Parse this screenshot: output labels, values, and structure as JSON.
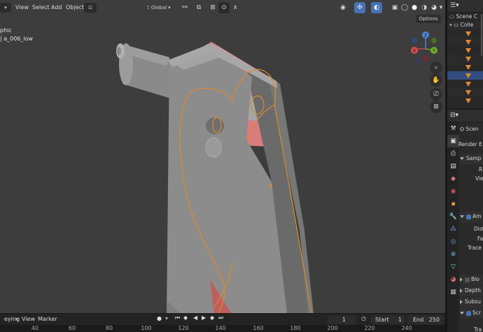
{
  "viewport": {
    "menu": [
      "View",
      "Select",
      "Add",
      "Object"
    ],
    "transform_orientation": "Global",
    "options_label": "Options",
    "overlay_line1": "phic",
    "overlay_line2": "| a_006_low"
  },
  "timeline": {
    "menu": [
      "eying",
      "View",
      "Marker"
    ],
    "current_frame": "1",
    "start_label": "Start",
    "start_value": "1",
    "end_label": "End",
    "end_value": "250",
    "ruler_ticks": [
      "40",
      "60",
      "80",
      "100",
      "120",
      "140",
      "160",
      "180",
      "200",
      "220",
      "240"
    ]
  },
  "outliner": {
    "scene_collection": "Scene C",
    "collection": "Colle"
  },
  "properties": {
    "scene_label": "Scen",
    "render_engine": "Render E",
    "sampling": "Samp",
    "sampling_r": "R",
    "sampling_vie": "Vie",
    "ao_label": "Am",
    "distance": "Dista",
    "factor": "Fa",
    "trace_p": "Trace P",
    "bloom": "Blo",
    "depth": "Depth",
    "subsurface": "Subsu",
    "screen": "Scr",
    "bottom_cut": "Tra"
  },
  "colors": {
    "accent": "#4772b3",
    "selection_orange": "#e0892a",
    "selected_row": "#334d80"
  }
}
